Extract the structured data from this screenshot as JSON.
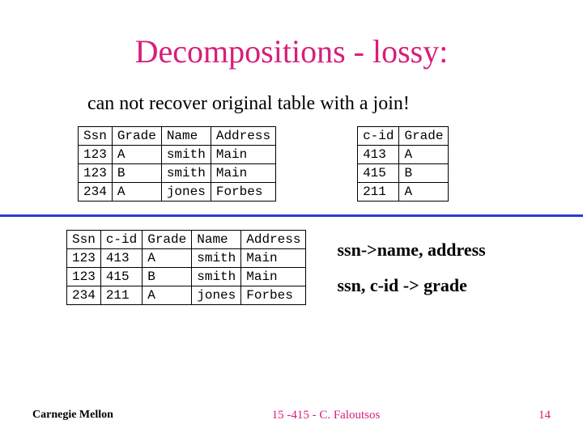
{
  "title": "Decompositions - lossy:",
  "subtitle": "can not recover original table with a join!",
  "table_left": {
    "headers": [
      "Ssn",
      "Grade",
      "Name",
      "Address"
    ],
    "rows": [
      [
        "123",
        "A",
        "smith",
        "Main"
      ],
      [
        "123",
        "B",
        "smith",
        "Main"
      ],
      [
        "234",
        "A",
        "jones",
        "Forbes"
      ]
    ]
  },
  "table_right": {
    "headers": [
      "c-id",
      "Grade"
    ],
    "rows": [
      [
        "413",
        "A"
      ],
      [
        "415",
        "B"
      ],
      [
        "211",
        "A"
      ]
    ]
  },
  "table_bottom": {
    "headers": [
      "Ssn",
      "c-id",
      "Grade",
      "Name",
      "Address"
    ],
    "rows": [
      [
        "123",
        "413",
        "A",
        "smith",
        "Main"
      ],
      [
        "123",
        "415",
        "B",
        "smith",
        "Main"
      ],
      [
        "234",
        "211",
        "A",
        "jones",
        "Forbes"
      ]
    ]
  },
  "fdeps": {
    "line1": "ssn->name, address",
    "line2": "ssn, c-id -> grade"
  },
  "footer": {
    "left": "Carnegie Mellon",
    "center": "15 -415 - C. Faloutsos",
    "right": "14"
  }
}
